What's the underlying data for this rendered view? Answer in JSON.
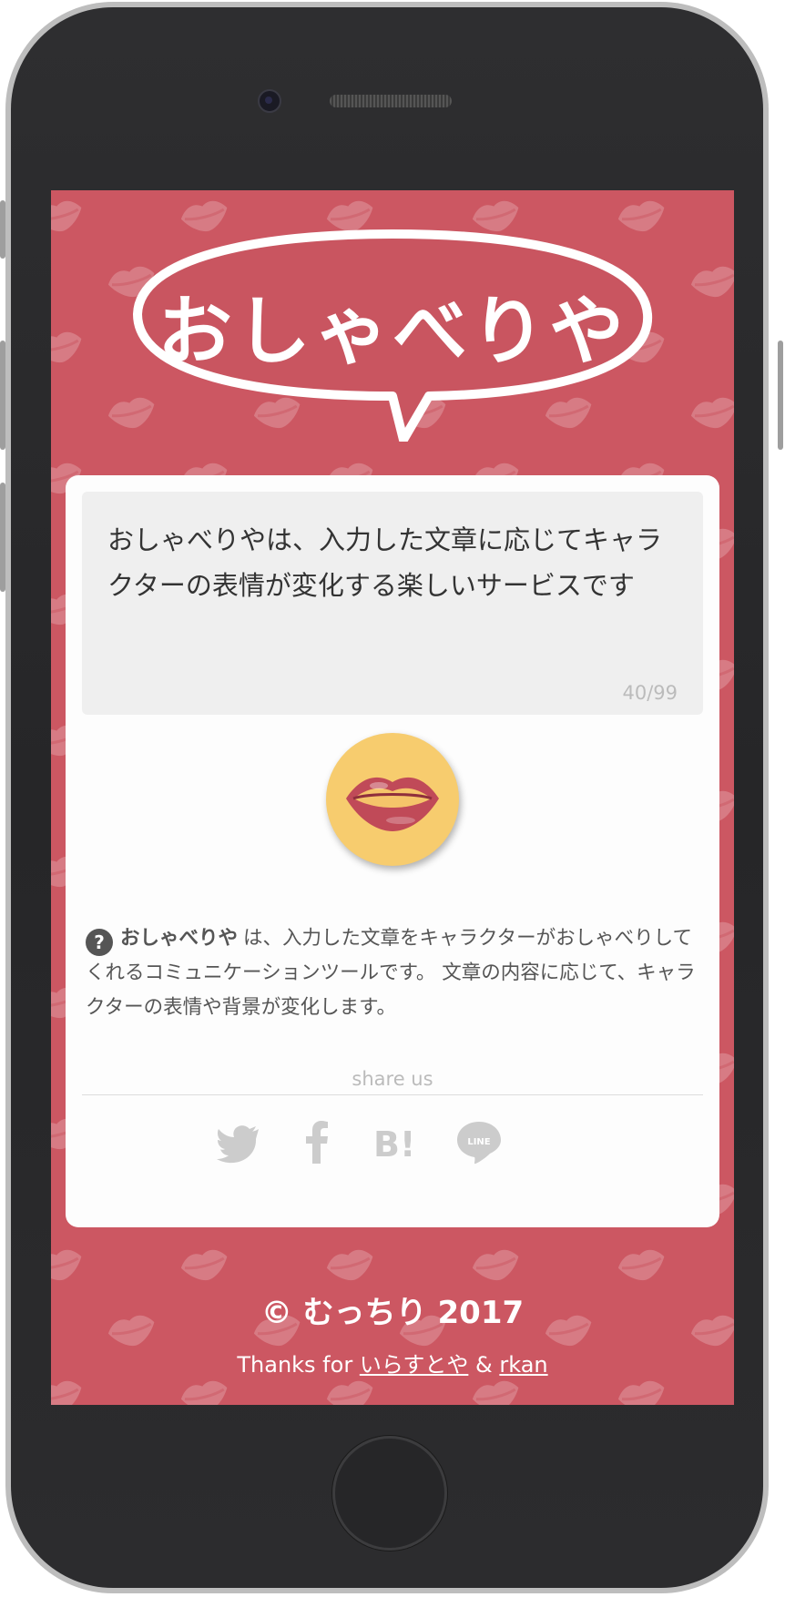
{
  "app": {
    "logo_text": "おしゃべりや",
    "brand_color": "#cc5762"
  },
  "input": {
    "text": "おしゃべりやは、入力した文章に応じてキャラクターの表情が変化する楽しいサービスです",
    "counter": "40/99"
  },
  "speak_button": {
    "icon": "lips-icon",
    "color": "#f7cc6e"
  },
  "description": {
    "help_icon": "?",
    "brand": "おしゃべりや",
    "text": "は、入力した文章をキャラクターがおしゃべりしてくれるコミュニケーションツールです。 文章の内容に応じて、キャラクターの表情や背景が変化します。"
  },
  "share": {
    "label": "share us",
    "icons": [
      "twitter-icon",
      "facebook-icon",
      "hatena-bookmark-icon",
      "line-icon"
    ]
  },
  "footer": {
    "copyright": "© むっちり 2017",
    "thanks_prefix": "Thanks for",
    "link1": "いらすとや",
    "separator": "&",
    "link2": "rkan"
  }
}
